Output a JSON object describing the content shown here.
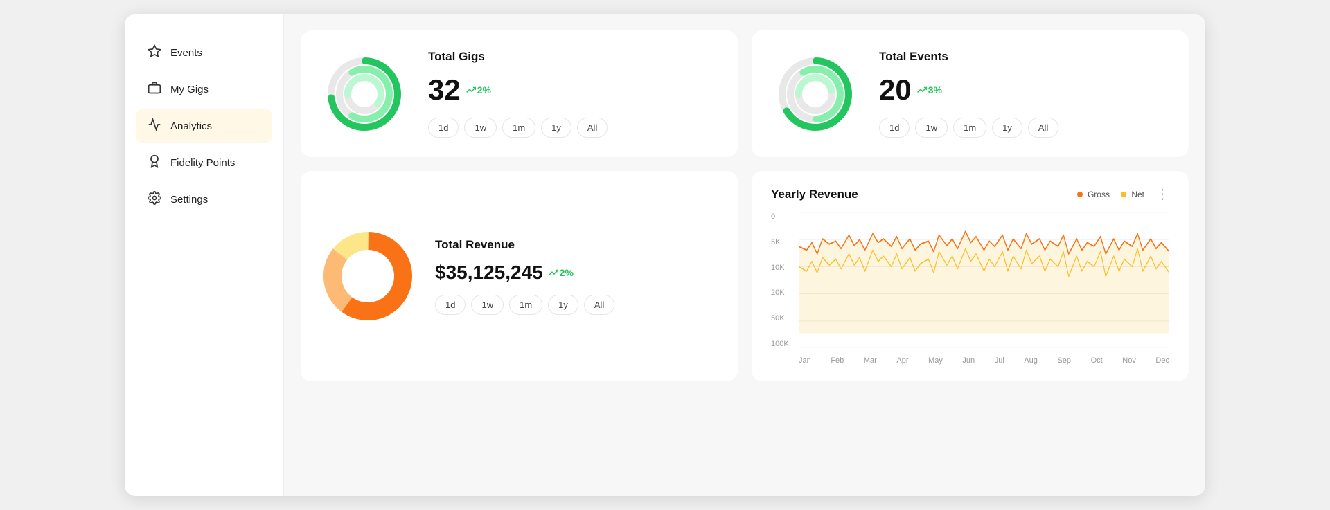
{
  "sidebar": {
    "items": [
      {
        "id": "events",
        "label": "Events",
        "icon": "★",
        "active": false
      },
      {
        "id": "my-gigs",
        "label": "My Gigs",
        "icon": "💼",
        "active": false
      },
      {
        "id": "analytics",
        "label": "Analytics",
        "icon": "📈",
        "active": true
      },
      {
        "id": "fidelity-points",
        "label": "Fidelity Points",
        "icon": "🏅",
        "active": false
      },
      {
        "id": "settings",
        "label": "Settings",
        "icon": "⚙️",
        "active": false
      }
    ]
  },
  "cards": {
    "total_gigs": {
      "title": "Total Gigs",
      "value": "32",
      "trend": "2%",
      "trend_direction": "up",
      "filters": [
        "1d",
        "1w",
        "1m",
        "1y",
        "All"
      ]
    },
    "total_events": {
      "title": "Total Events",
      "value": "20",
      "trend": "3%",
      "trend_direction": "up",
      "filters": [
        "1d",
        "1w",
        "1m",
        "1y",
        "All"
      ]
    },
    "total_revenue": {
      "title": "Total Revenue",
      "value": "$35,125,245",
      "trend": "2%",
      "trend_direction": "up",
      "filters": [
        "1d",
        "1w",
        "1m",
        "1y",
        "All"
      ]
    }
  },
  "yearly_revenue": {
    "title": "Yearly Revenue",
    "legend": [
      {
        "label": "Gross",
        "color": "#f97316"
      },
      {
        "label": "Net",
        "color": "#fbbf24"
      }
    ],
    "y_labels": [
      "100K",
      "50K",
      "20K",
      "10K",
      "5K",
      "0"
    ],
    "x_labels": [
      "Jan",
      "Feb",
      "Mar",
      "Apr",
      "May",
      "Jun",
      "Jul",
      "Aug",
      "Sep",
      "Oct",
      "Nov",
      "Dec"
    ]
  }
}
